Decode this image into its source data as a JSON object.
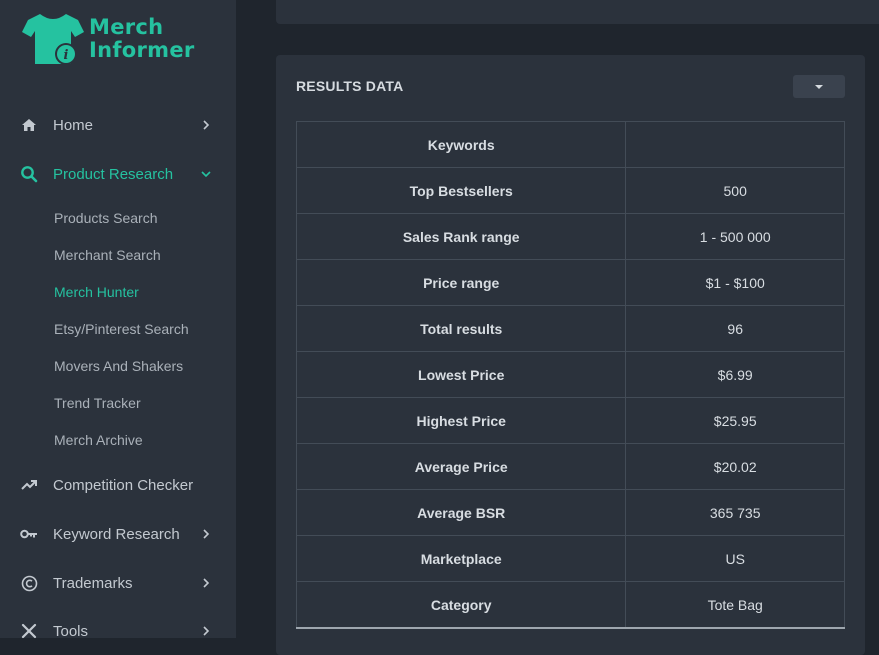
{
  "brand": {
    "line1": "Merch",
    "line2": "Informer",
    "color": "#25c2a0"
  },
  "nav": {
    "home": "Home",
    "product_research": "Product Research",
    "sub": [
      "Products Search",
      "Merchant Search",
      "Merch Hunter",
      "Etsy/Pinterest Search",
      "Movers And Shakers",
      "Trend Tracker",
      "Merch Archive"
    ],
    "active_sub": "Merch Hunter",
    "competition_checker": "Competition Checker",
    "keyword_research": "Keyword Research",
    "trademarks": "Trademarks",
    "tools": "Tools"
  },
  "icons": {
    "home": "home-icon",
    "search": "search-icon",
    "trend": "trending-up-icon",
    "key": "key-icon",
    "copyright": "copyright-icon",
    "tools": "wrench-icon"
  },
  "results": {
    "title": "RESULTS DATA",
    "rows": [
      {
        "key": "Keywords",
        "value": ""
      },
      {
        "key": "Top Bestsellers",
        "value": "500"
      },
      {
        "key": "Sales Rank range",
        "value": "1 - 500 000"
      },
      {
        "key": "Price range",
        "value": "$1 - $100"
      },
      {
        "key": "Total results",
        "value": "96"
      },
      {
        "key": "Lowest Price",
        "value": "$6.99"
      },
      {
        "key": "Highest Price",
        "value": "$25.95"
      },
      {
        "key": "Average Price",
        "value": "$20.02"
      },
      {
        "key": "Average BSR",
        "value": "365 735"
      },
      {
        "key": "Marketplace",
        "value": "US"
      },
      {
        "key": "Category",
        "value": "Tote Bag"
      }
    ]
  },
  "colors": {
    "accent": "#25c2a0",
    "sidebar": "#2b323c",
    "background": "#1f252d"
  }
}
